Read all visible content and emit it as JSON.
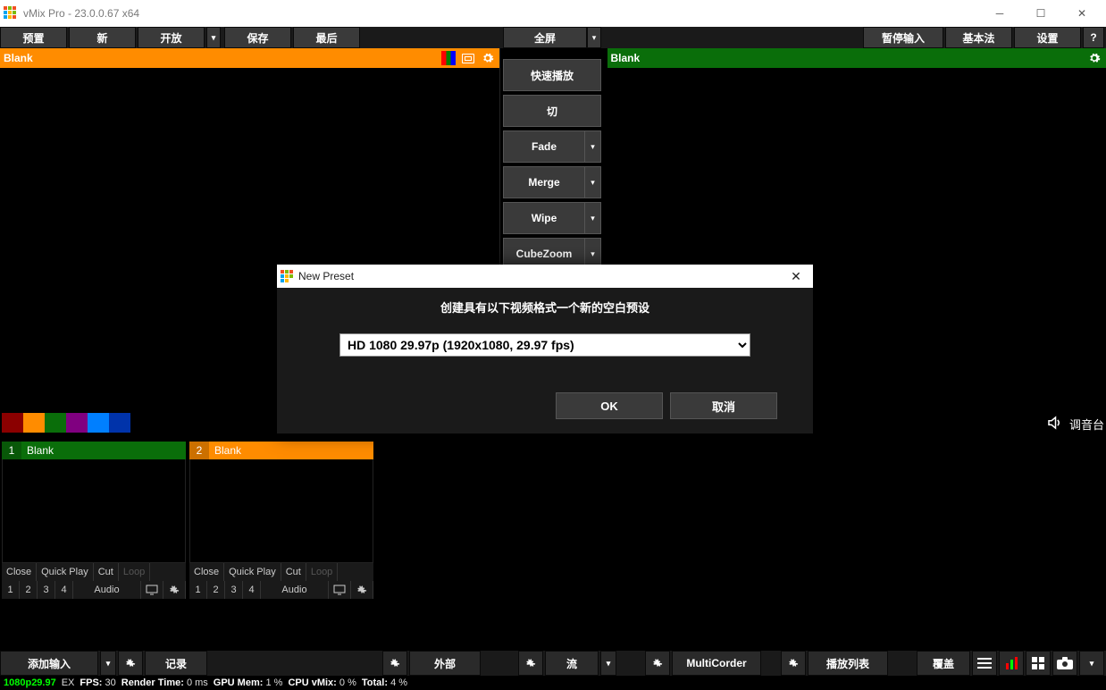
{
  "window": {
    "title": "vMix Pro - 23.0.0.67 x64"
  },
  "toolbar": {
    "preset": "预置",
    "new": "新",
    "open": "开放",
    "save": "保存",
    "last": "最后",
    "fullscreen": "全屏",
    "pause_input": "暂停输入",
    "basic": "基本法",
    "settings": "设置",
    "help": "?"
  },
  "preview": {
    "title": "Blank"
  },
  "output": {
    "title": "Blank"
  },
  "transitions": {
    "quick": "快速播放",
    "cut": "切",
    "fade": "Fade",
    "merge": "Merge",
    "wipe": "Wipe",
    "cubezoom": "CubeZoom"
  },
  "swatch_colors": [
    "#8b0000",
    "#ff8c00",
    "#0a6e0a",
    "#800080",
    "#007fff",
    "#0033aa"
  ],
  "audio_panel": {
    "label": "调音台"
  },
  "inputs": [
    {
      "num": "1",
      "name": "Blank",
      "color": "green"
    },
    {
      "num": "2",
      "name": "Blank",
      "color": "orange"
    }
  ],
  "input_ctrl1": {
    "close": "Close",
    "quick_play": "Quick Play",
    "cut": "Cut",
    "loop": "Loop"
  },
  "input_ctrl2": {
    "n1": "1",
    "n2": "2",
    "n3": "3",
    "n4": "4",
    "audio": "Audio"
  },
  "bottom": {
    "add_input": "添加输入",
    "record": "记录",
    "external": "外部",
    "stream": "流",
    "multicorder": "MultiCorder",
    "playlist": "播放列表",
    "overlay": "覆盖"
  },
  "status": {
    "res": "1080p29.97",
    "ex": "EX",
    "fps_lbl": "FPS:",
    "fps": "30",
    "rt_lbl": "Render Time:",
    "rt": "0 ms",
    "gm_lbl": "GPU Mem:",
    "gm": "1 %",
    "cv_lbl": "CPU vMix:",
    "cv": "0 %",
    "tot_lbl": "Total:",
    "tot": "4 %"
  },
  "dialog": {
    "title": "New Preset",
    "message": "创建具有以下视频格式一个新的空白预设",
    "option": "HD 1080 29.97p           (1920x1080, 29.97 fps)",
    "ok": "OK",
    "cancel": "取消"
  }
}
